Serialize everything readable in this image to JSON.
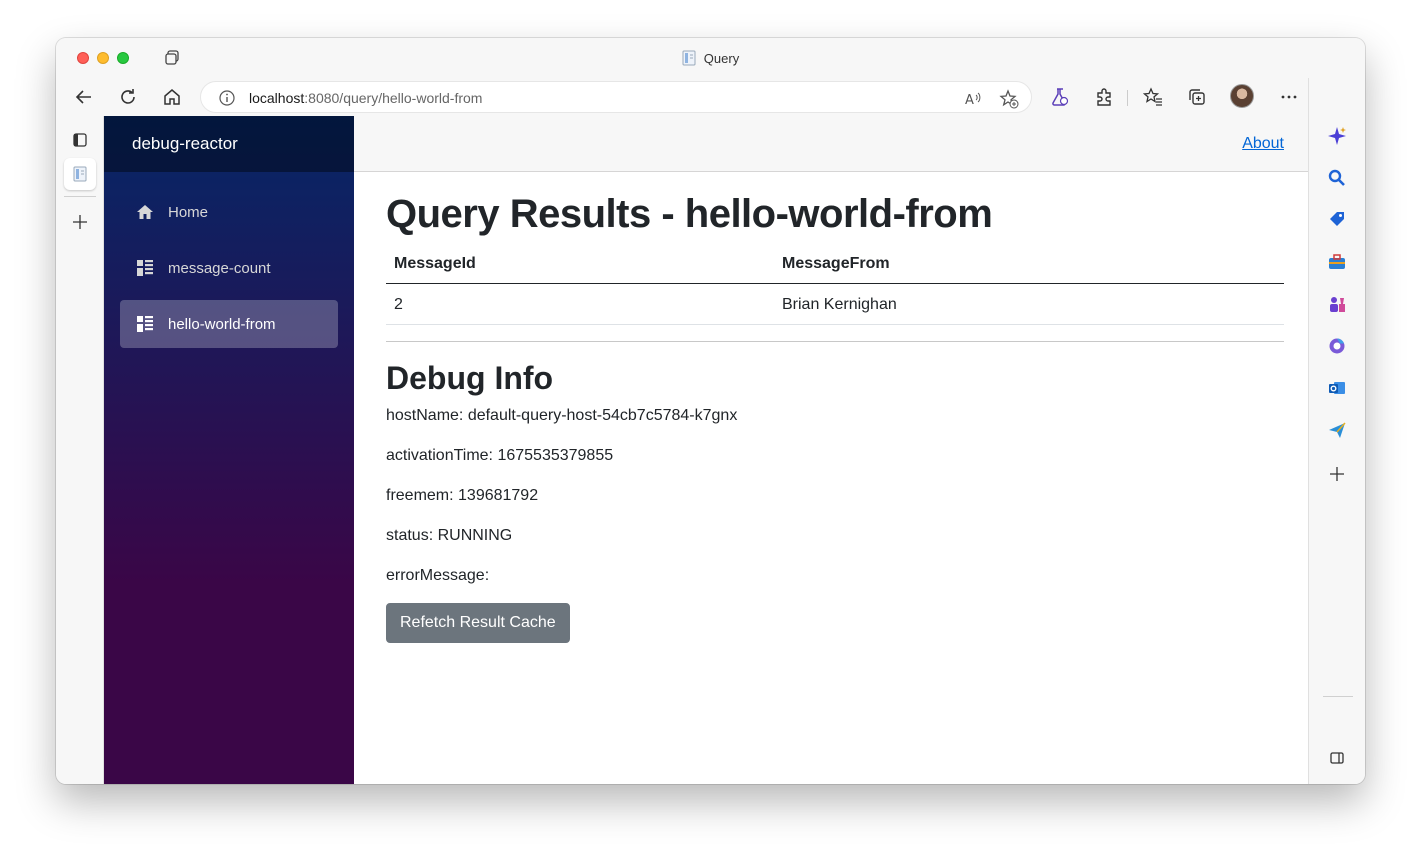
{
  "window": {
    "title": "Query"
  },
  "addressbar": {
    "host": "localhost",
    "path": ":8080/query/hello-world-from"
  },
  "app": {
    "brand": "debug-reactor",
    "nav": [
      {
        "label": "Home",
        "icon": "home-icon",
        "active": false
      },
      {
        "label": "message-count",
        "icon": "dashboard-icon",
        "active": false
      },
      {
        "label": "hello-world-from",
        "icon": "dashboard-icon",
        "active": true
      }
    ],
    "about_link": "About"
  },
  "main": {
    "title": "Query Results - hello-world-from",
    "table": {
      "columns": [
        "MessageId",
        "MessageFrom"
      ],
      "rows": [
        [
          "2",
          "Brian Kernighan"
        ]
      ]
    },
    "debug": {
      "title": "Debug Info",
      "hostName": "hostName: default-query-host-54cb7c5784-k7gnx",
      "activationTime": "activationTime: 1675535379855",
      "freemem": "freemem: 139681792",
      "status": "status: RUNNING",
      "errorMessage": "errorMessage:"
    },
    "refetch_button": "Refetch Result Cache"
  },
  "colors": {
    "sidebar_top": "#052767",
    "sidebar_bottom": "#3a0647",
    "button": "#6c757d",
    "link": "#0366d6"
  }
}
